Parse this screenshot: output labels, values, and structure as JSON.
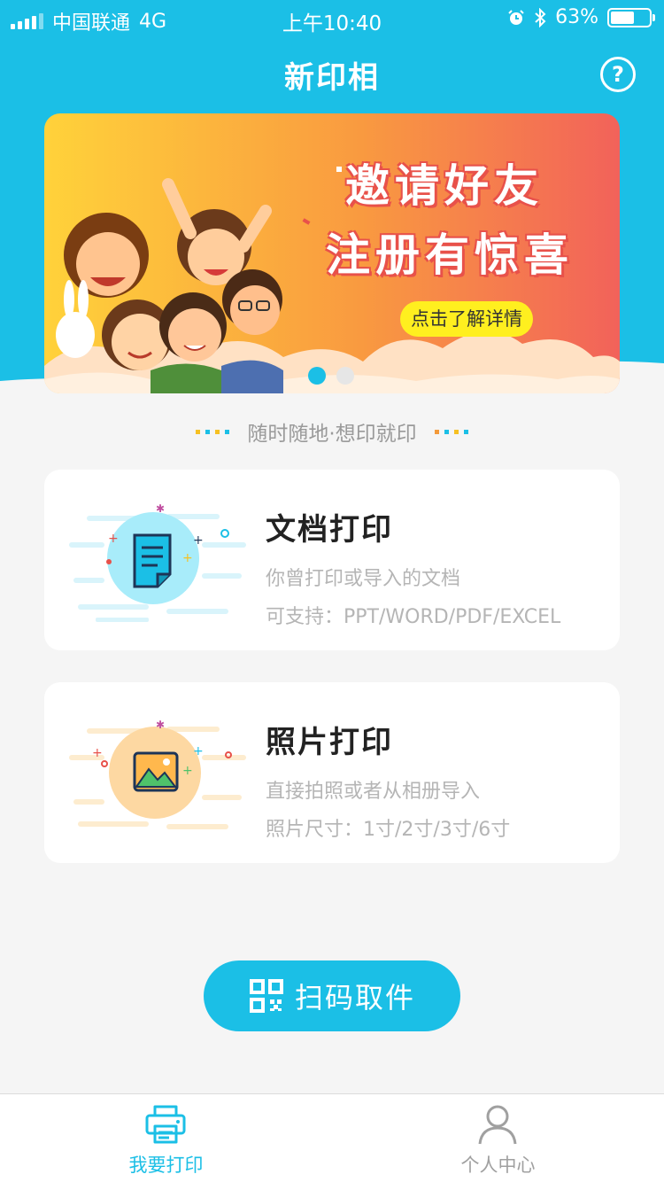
{
  "status_bar": {
    "carrier": "中国联通",
    "network": "4G",
    "time": "上午10:40",
    "battery_percent": "63%",
    "battery_level": 0.63
  },
  "nav": {
    "title": "新印相",
    "help_icon": "question-circle-icon",
    "help_glyph": "?"
  },
  "banner": {
    "title_line1": "邀请好友",
    "title_line2": "注册有惊喜",
    "cta": "点击了解详情",
    "page_count": 2,
    "active_page": 1
  },
  "slogan": "随时随地·想印就印",
  "cards": [
    {
      "title": "文档打印",
      "desc1": "你曾打印或导入的文档",
      "desc2": "可支持：PPT/WORD/PDF/EXCEL",
      "icon": "document-icon"
    },
    {
      "title": "照片打印",
      "desc1": "直接拍照或者从相册导入",
      "desc2": "照片尺寸：1寸/2寸/3寸/6寸",
      "icon": "photo-icon"
    }
  ],
  "scan_button": {
    "label": "扫码取件",
    "icon": "qr-code-icon"
  },
  "tabbar": {
    "items": [
      {
        "label": "我要打印",
        "icon": "printer-icon",
        "active": true
      },
      {
        "label": "个人中心",
        "icon": "user-icon",
        "active": false
      }
    ]
  },
  "colors": {
    "primary": "#1bbfe6",
    "background": "#f5f5f5",
    "banner_cta": "#ffef1f",
    "text_dark": "#222222",
    "text_muted": "#b5b5b5"
  }
}
